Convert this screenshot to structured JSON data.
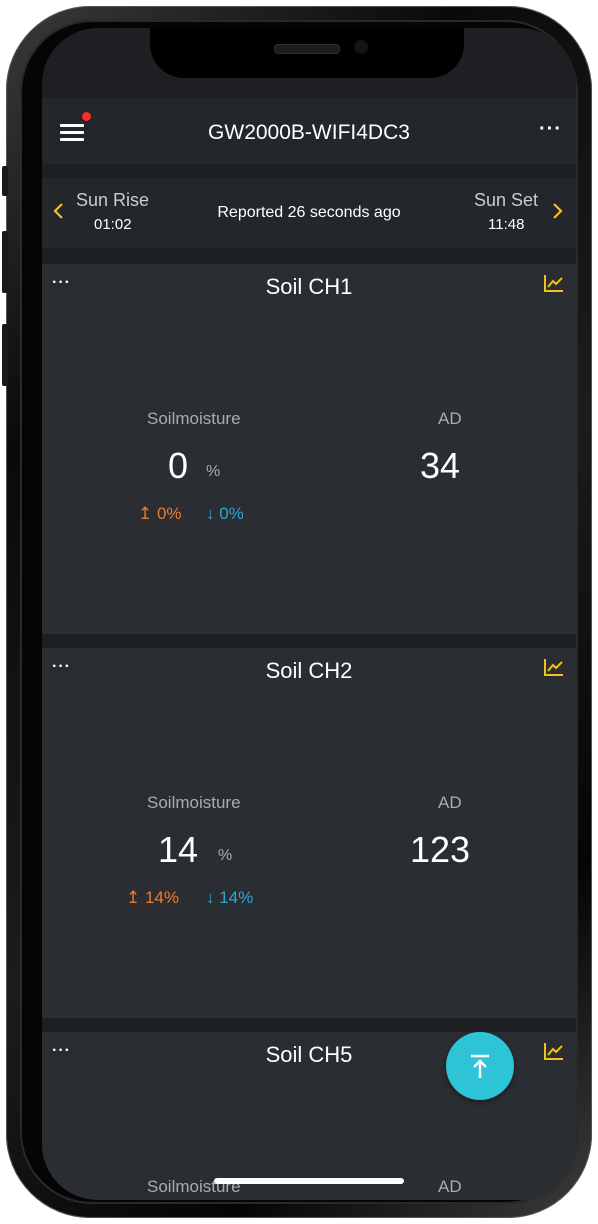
{
  "header": {
    "title": "GW2000B-WIFI4DC3",
    "more_label": "···"
  },
  "sun": {
    "rise_label": "Sun Rise",
    "rise_time": "01:02",
    "set_label": "Sun Set",
    "set_time": "11:48",
    "reported": "Reported 26 seconds ago",
    "prev_icon": "chevron-left-icon",
    "next_icon": "chevron-right-icon"
  },
  "cards": [
    {
      "title": "Soil CH1",
      "more": "···",
      "moisture_label": "Soilmoisture",
      "moisture_value": "0",
      "moisture_unit": "%",
      "high": "↥ 0%",
      "low": "↓ 0%",
      "ad_label": "AD",
      "ad_value": "34"
    },
    {
      "title": "Soil CH2",
      "more": "···",
      "moisture_label": "Soilmoisture",
      "moisture_value": "14",
      "moisture_unit": "%",
      "high": "↥ 14%",
      "low": "↓ 14%",
      "ad_label": "AD",
      "ad_value": "123"
    },
    {
      "title": "Soil CH5",
      "more": "···",
      "moisture_label": "Soilmoisture",
      "ad_label": "AD"
    }
  ],
  "colors": {
    "accent_yellow": "#f2c21b",
    "high_orange": "#f07a2c",
    "low_blue": "#2aa8d9",
    "fab_cyan": "#2ec4d8",
    "notification_red": "#ff2a2a"
  },
  "fab_icon": "scroll-to-top-icon"
}
